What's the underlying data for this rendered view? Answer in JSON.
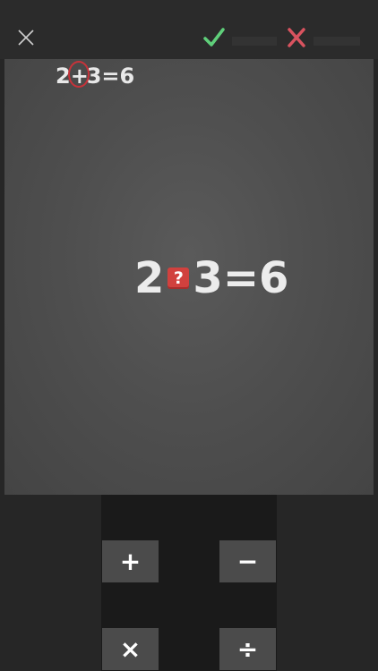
{
  "header": {
    "close_icon": "close-icon",
    "correct_icon": "check-icon",
    "wrong_icon": "cross-icon"
  },
  "previous_equation": {
    "left": "2",
    "operator": "+",
    "right": "3",
    "equals": "=",
    "result": "6"
  },
  "current_equation": {
    "left": "2",
    "unknown": "?",
    "right": "3",
    "equals": "=",
    "result": "6"
  },
  "operators": {
    "plus": "+",
    "minus": "−",
    "times": "×",
    "divide": "÷"
  },
  "colors": {
    "board": "#4f4f4f",
    "correct": "#5fcf7a",
    "wrong": "#d9535f",
    "button": "#4b4b4b"
  }
}
